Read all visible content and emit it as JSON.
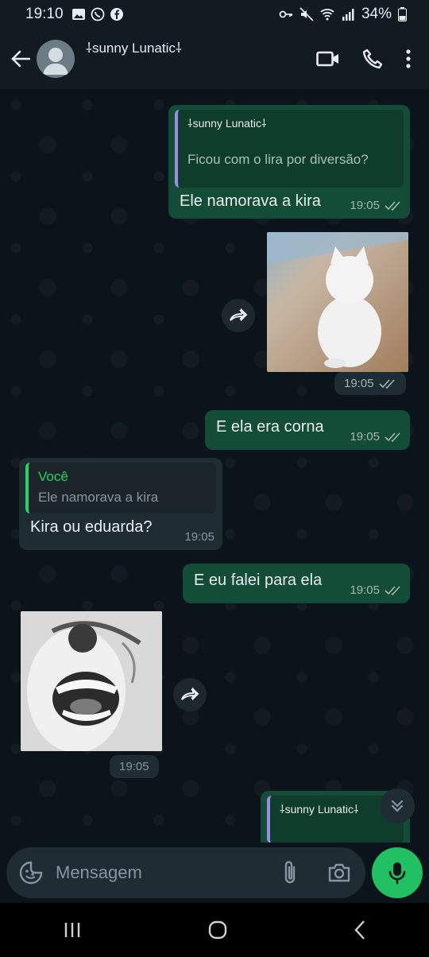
{
  "status_bar": {
    "time": "19:10",
    "battery": "34%"
  },
  "header": {
    "contact_name": "⸸sunny Lunatic⸸"
  },
  "messages": [
    {
      "quote_author": "⸸sunny Lunatic⸸",
      "quote_text": "Ficou com o lira por diversão?",
      "text": "Ele namorava a kira",
      "time": "19:05"
    },
    {
      "time": "19:05"
    },
    {
      "text": "E ela era corna",
      "time": "19:05"
    },
    {
      "quote_author": "Você",
      "quote_text": "Ele namorava a kira",
      "text": "Kira ou eduarda?",
      "time": "19:05"
    },
    {
      "text": "E eu falei para ela",
      "time": "19:05"
    },
    {
      "time": "19:05"
    },
    {
      "quote_author": "⸸sunny Lunatic⸸"
    }
  ],
  "composer": {
    "placeholder": "Mensagem"
  },
  "icons": {
    "back": "arrow-left-icon",
    "video": "video-call-icon",
    "call": "phone-icon",
    "menu": "more-vert-icon",
    "emoji": "sticker-icon",
    "attach": "paperclip-icon",
    "camera": "camera-icon",
    "mic": "mic-icon",
    "forward": "forward-icon",
    "scroll": "chevrons-down-icon"
  },
  "colors": {
    "outgoing_bubble": "#144d37",
    "incoming_bubble": "#202c33",
    "accent": "#21c063",
    "background": "#0b141a"
  }
}
